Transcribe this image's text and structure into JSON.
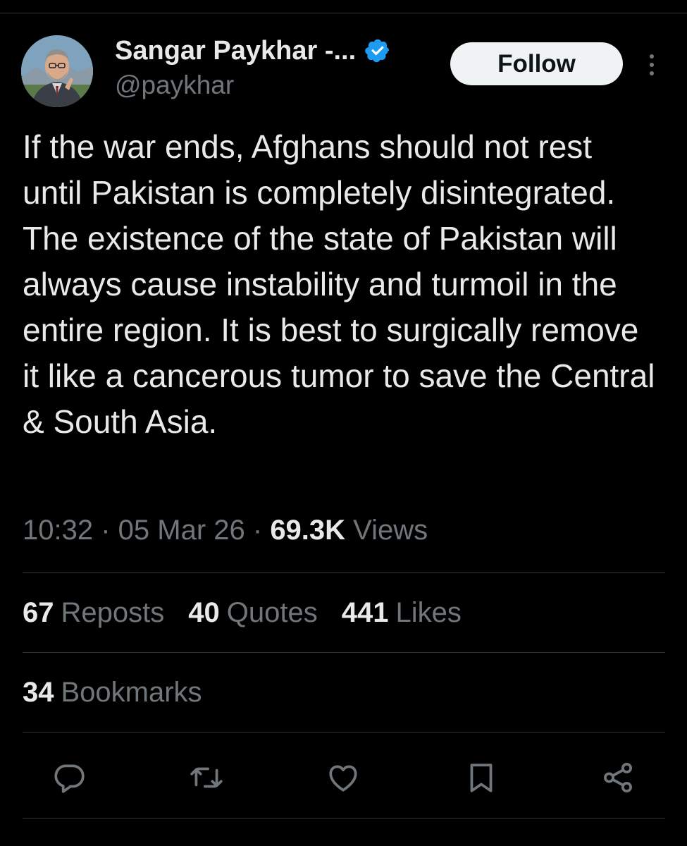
{
  "tweet": {
    "author": {
      "display_name": "Sangar Paykhar -...",
      "handle": "@paykhar",
      "verified": true,
      "verified_color": "#1d9bf0"
    },
    "follow_label": "Follow",
    "text": "If the war ends, Afghans should not rest until Pakistan is completely disintegrated. The existence of the state of Pakistan will always cause instability and turmoil in the entire region. It is best to surgically remove it like a cancerous tumor to save the Central & South Asia.",
    "time": "10:32",
    "date": "05 Mar 26",
    "separator": "·",
    "views_count": "69.3K",
    "views_label": "Views",
    "stats": {
      "reposts_count": "67",
      "reposts_label": "Reposts",
      "quotes_count": "40",
      "quotes_label": "Quotes",
      "likes_count": "441",
      "likes_label": "Likes",
      "bookmarks_count": "34",
      "bookmarks_label": "Bookmarks"
    }
  },
  "actions": {
    "icons": [
      "reply-icon",
      "retweet-icon",
      "like-icon",
      "bookmark-icon",
      "share-icon"
    ]
  },
  "theme": {
    "background": "#000000",
    "text_primary": "#e7e9ea",
    "text_secondary": "#71767b",
    "divider": "#2f3336",
    "follow_bg": "#eff3f4"
  }
}
